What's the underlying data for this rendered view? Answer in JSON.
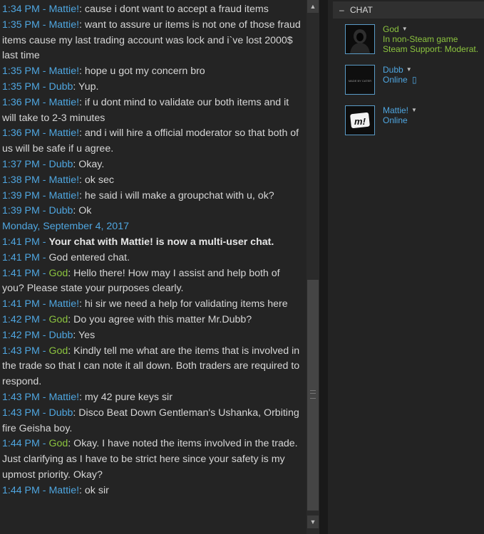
{
  "chat_lines": [
    {
      "time": "1:34 PM",
      "name": "Mattie!",
      "name_class": "mattie",
      "text": "cause i dont want to accept a fraud items"
    },
    {
      "time": "1:35 PM",
      "name": "Mattie!",
      "name_class": "mattie",
      "text": "want to assure ur items is not one of those fraud items cause my last trading account was lock and i`ve lost 2000$ last time"
    },
    {
      "time": "1:35 PM",
      "name": "Mattie!",
      "name_class": "mattie",
      "text": "hope u got my concern bro"
    },
    {
      "time": "1:35 PM",
      "name": "Dubb",
      "name_class": "dubb",
      "text": "Yup."
    },
    {
      "time": "1:36 PM",
      "name": "Mattie!",
      "name_class": "mattie",
      "text": "if u dont mind to validate our both items and it will take to 2-3 minutes"
    },
    {
      "time": "1:36 PM",
      "name": "Mattie!",
      "name_class": "mattie",
      "text": "and i will hire a official moderator so that both of us will be safe if u agree."
    },
    {
      "time": "1:37 PM",
      "name": "Dubb",
      "name_class": "dubb",
      "text": "Okay."
    },
    {
      "time": "1:38 PM",
      "name": "Mattie!",
      "name_class": "mattie",
      "text": "ok sec"
    },
    {
      "time": "1:39 PM",
      "name": "Mattie!",
      "name_class": "mattie",
      "text": "he said i will make a groupchat with u, ok?"
    },
    {
      "time": "1:39 PM",
      "name": "Dubb",
      "name_class": "dubb",
      "text": "Ok"
    },
    {
      "kind": "date",
      "text": "Monday, September 4, 2017"
    },
    {
      "kind": "system_bold",
      "time": "1:41 PM",
      "text": "Your chat with Mattie! is now a multi-user chat."
    },
    {
      "kind": "system",
      "time": "1:41 PM",
      "text": "God entered chat."
    },
    {
      "time": "1:41 PM",
      "name": "God",
      "name_class": "god",
      "text": "Hello there! How may I assist and help both of you? Please state your purposes clearly."
    },
    {
      "time": "1:41 PM",
      "name": "Mattie!",
      "name_class": "mattie",
      "text": "hi sir we need a help for validating items here"
    },
    {
      "time": "1:42 PM",
      "name": "God",
      "name_class": "god",
      "text": "Do you agree with this matter Mr.Dubb?"
    },
    {
      "time": "1:42 PM",
      "name": "Dubb",
      "name_class": "dubb",
      "text": "Yes"
    },
    {
      "time": "1:43 PM",
      "name": "God",
      "name_class": "god",
      "text": "Kindly tell me what are the items that is involved in the trade so that I can note it all down. Both traders are required to respond."
    },
    {
      "time": "1:43 PM",
      "name": "Mattie!",
      "name_class": "mattie",
      "text": "my 42 pure keys sir"
    },
    {
      "time": "1:43 PM",
      "name": "Dubb",
      "name_class": "dubb",
      "text": "Disco Beat Down Gentleman's Ushanka, Orbiting fire Geisha boy."
    },
    {
      "time": "1:44 PM",
      "name": "God",
      "name_class": "god",
      "text": "Okay. I have noted the items involved in the trade. Just clarifying as I have to be strict here since your safety is my upmost priority. Okay?"
    },
    {
      "time": "1:44 PM",
      "name": "Mattie!",
      "name_class": "mattie",
      "text": "ok sir"
    }
  ],
  "separator": " - ",
  "colon": ": ",
  "scrollbar": {
    "up_icon": "up-arrow-icon",
    "down_icon": "down-arrow-icon",
    "up_glyph": "▲",
    "down_glyph": "▼"
  },
  "sidebar": {
    "minus_glyph": "–",
    "title": "CHAT",
    "members": [
      {
        "name": "God",
        "status_lines": [
          "In non-Steam game",
          "Steam Support: Moderat."
        ],
        "color": "green"
      },
      {
        "name": "Dubb",
        "status_lines": [
          "Online"
        ],
        "color": "blue",
        "mobile": true,
        "avatar_text": "MADE BY CATER"
      },
      {
        "name": "Mattie!",
        "status_lines": [
          "Online"
        ],
        "color": "blue",
        "avatar_text": "m!"
      }
    ],
    "arrow_glyph": "▼",
    "phone_glyph": "▯"
  },
  "colors": {
    "timestamp": "#4fa6e0",
    "god_name": "#8cc43f",
    "bg": "#242424"
  }
}
